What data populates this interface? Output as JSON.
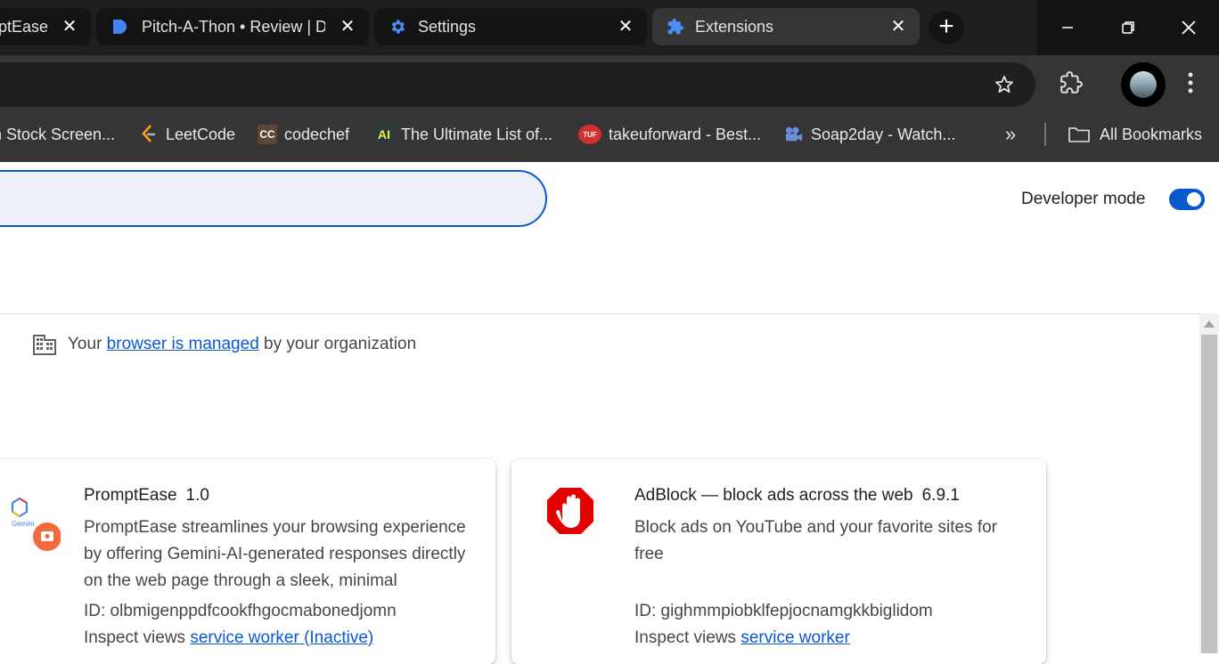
{
  "tabs": [
    {
      "title": "PromptEase",
      "active": false
    },
    {
      "title": "Pitch-A-Thon • Review | D",
      "active": false
    },
    {
      "title": "Settings",
      "active": false
    },
    {
      "title": "Extensions",
      "active": true
    }
  ],
  "bookmarks": [
    {
      "label": "n Stock Screen..."
    },
    {
      "label": "LeetCode"
    },
    {
      "label": "codechef",
      "icon_text": "CC"
    },
    {
      "label": "The Ultimate List of...",
      "icon_text": "AI"
    },
    {
      "label": "takeuforward - Best...",
      "icon_text": "TUF"
    },
    {
      "label": "Soap2day - Watch..."
    },
    {
      "label": "All Bookmarks"
    }
  ],
  "page": {
    "developer_mode_label": "Developer mode",
    "developer_mode_on": true,
    "managed": {
      "prefix": "Your",
      "link": "browser is managed",
      "suffix": "by your organization"
    }
  },
  "extensions": [
    {
      "name": "PromptEase",
      "version": "1.0",
      "description": "PromptEase streamlines your browsing experience by offering Gemini-AI-generated responses directly on the web page through a sleek, minimal",
      "id_label": "ID: olbmigenppdfcookfhgocmabonedjomn",
      "inspect_label": "Inspect views",
      "inspect_link": "service worker (Inactive)",
      "icon_text": "Gemini"
    },
    {
      "name": "AdBlock — block ads across the web",
      "version": "6.9.1",
      "description": "Block ads on YouTube and your favorite sites for free",
      "id_label": "ID: gighmmpiobklfepjocnamgkkbiglidom",
      "inspect_label": "Inspect views",
      "inspect_link": "service worker"
    }
  ],
  "colors": {
    "accent": "#0b57d0",
    "frame": "#1f1f1f",
    "toolbar": "#353535"
  }
}
